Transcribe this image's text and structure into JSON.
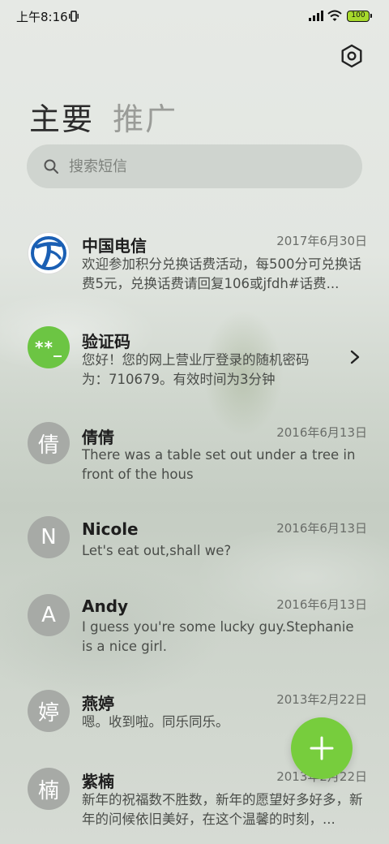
{
  "status_bar": {
    "time": "上午8:16",
    "battery": "100",
    "icons": [
      "vibrate-icon",
      "signal-icon",
      "wifi-icon",
      "battery-icon"
    ]
  },
  "header": {
    "settings_icon": "hexagon-settings-icon",
    "tabs": [
      {
        "label": "主要",
        "active": true
      },
      {
        "label": "推广",
        "active": false
      }
    ]
  },
  "search": {
    "placeholder": "搜索短信",
    "value": ""
  },
  "messages": [
    {
      "name": "中国电信",
      "avatar": "china-telecom-logo",
      "date": "2017年6月30日",
      "snippet": "欢迎参加积分兑换话费活动，每500分可兑换话费5元，兑换话费请回复106或jfdh#话费..."
    },
    {
      "name": "验证码",
      "avatar": "**_",
      "date": "",
      "snippet": "您好！您的网上营业厅登录的随机密码为：710679。有效时间为3分钟"
    },
    {
      "name": "倩倩",
      "avatar": "倩",
      "date": "2016年6月13日",
      "snippet": "There was a table set out under a tree in front of the hous"
    },
    {
      "name": "Nicole",
      "avatar": "N",
      "date": "2016年6月13日",
      "snippet": "Let's eat out,shall we?"
    },
    {
      "name": "Andy",
      "avatar": "A",
      "date": "2016年6月13日",
      "snippet": "I guess you're some lucky guy.Stephanie is a nice girl."
    },
    {
      "name": "燕婷",
      "avatar": "婷",
      "date": "2013年2月22日",
      "snippet": "嗯。收到啦。同乐同乐。"
    },
    {
      "name": "紫楠",
      "avatar": "楠",
      "date": "2013年2月22日",
      "snippet": "新年的祝福数不胜数，新年的愿望好多好多，新年的问候依旧美好，在这个温馨的时刻，..."
    }
  ],
  "fab": {
    "icon": "plus-icon"
  },
  "colors": {
    "accent_green": "#77cd3d",
    "avatar_gray": "#a7aaa6",
    "telecom_blue": "#1a5fb4"
  }
}
